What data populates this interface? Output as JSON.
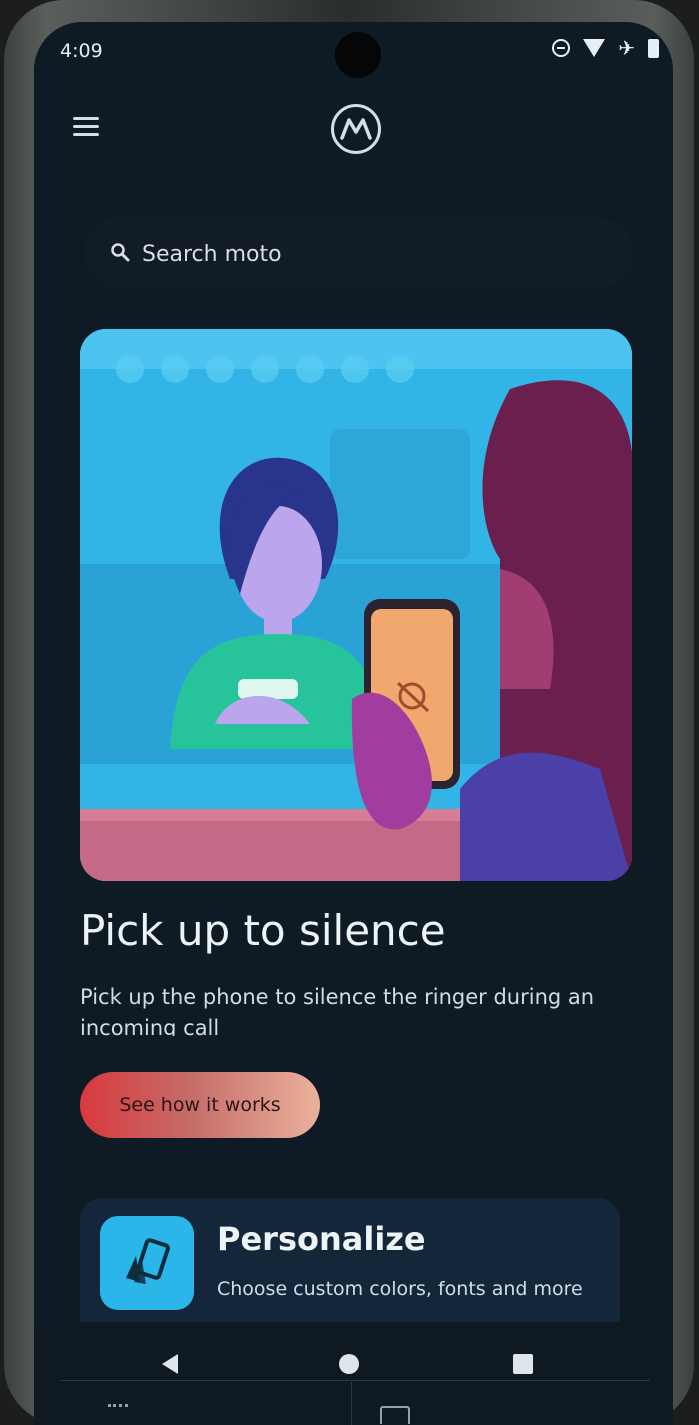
{
  "status_bar": {
    "time": "4:09"
  },
  "header": {
    "menu_icon": "menu-icon",
    "logo": "motorola-logo"
  },
  "search": {
    "placeholder": "Search moto"
  },
  "feature": {
    "title": "Pick up to silence",
    "description": "Pick up the phone to silence the ringer during an incoming call",
    "cta_label": "See how it works"
  },
  "personalize": {
    "title": "Personalize",
    "description": "Choose custom colors, fonts and more"
  },
  "colors": {
    "accent": "#2ab6e9",
    "background": "#0e1a24",
    "cta_start": "#d9393d",
    "cta_end": "#ebb19c"
  }
}
